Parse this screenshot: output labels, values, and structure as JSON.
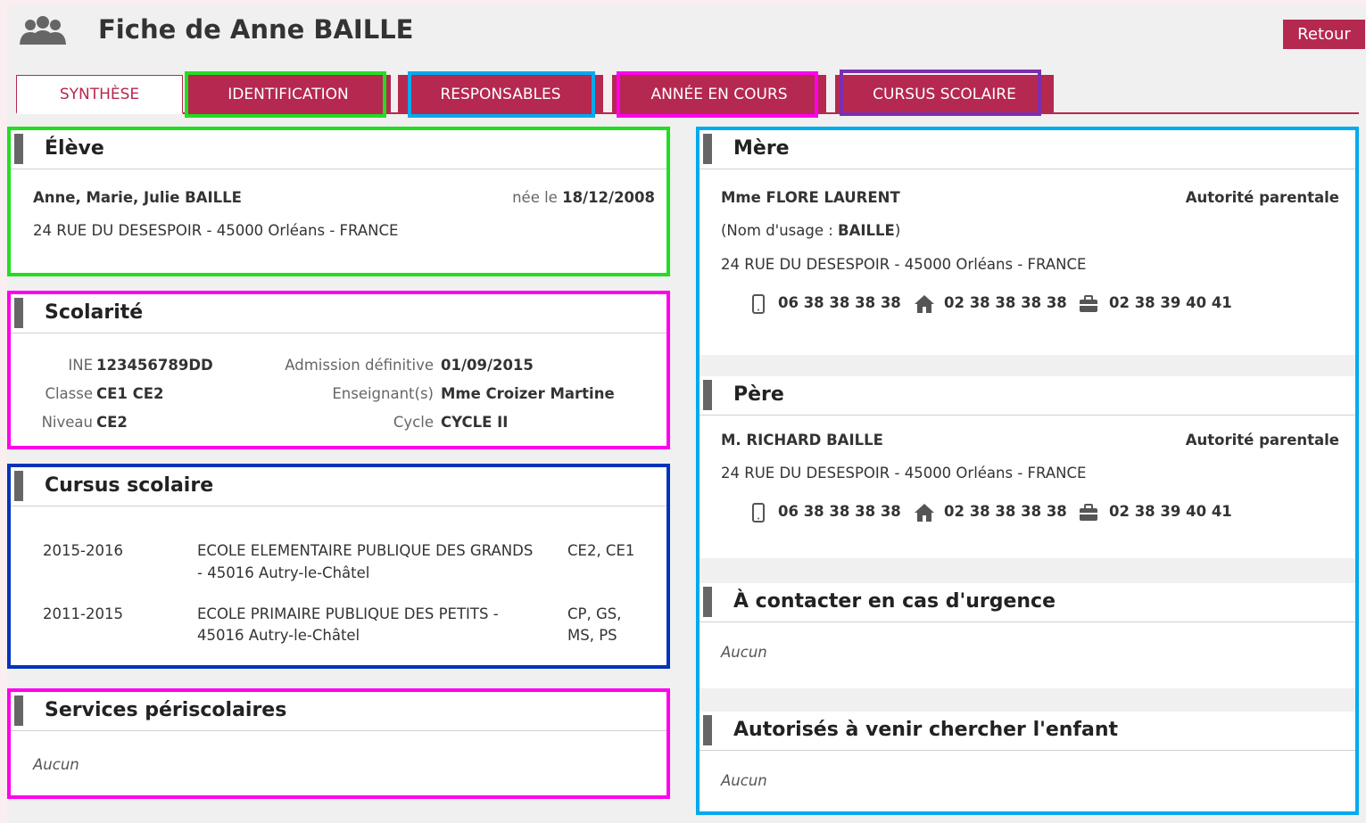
{
  "header": {
    "title": "Fiche de Anne BAILLE",
    "back_label": "Retour",
    "icon": "group-icon"
  },
  "tabs": [
    {
      "label": "SYNTHÈSE",
      "active": true
    },
    {
      "label": "IDENTIFICATION",
      "active": false
    },
    {
      "label": "RESPONSABLES",
      "active": false
    },
    {
      "label": "ANNÉE EN COURS",
      "active": false
    },
    {
      "label": "CURSUS SCOLAIRE",
      "active": false
    }
  ],
  "eleve": {
    "title": "Élève",
    "name": "Anne, Marie, Julie BAILLE",
    "born_label": "née le",
    "born_date": "18/12/2008",
    "address": "24 RUE DU DESESPOIR - 45000 Orléans - FRANCE"
  },
  "scolarite": {
    "title": "Scolarité",
    "ine_label": "INE",
    "ine": "123456789DD",
    "classe_label": "Classe",
    "classe": "CE1 CE2",
    "niveau_label": "Niveau",
    "niveau": "CE2",
    "admission_label": "Admission définitive",
    "admission": "01/09/2015",
    "enseignant_label": "Enseignant(s)",
    "enseignant": "Mme Croizer Martine",
    "cycle_label": "Cycle",
    "cycle": "CYCLE II"
  },
  "cursus": {
    "title": "Cursus scolaire",
    "rows": [
      {
        "years": "2015-2016",
        "school_line1": "ECOLE ELEMENTAIRE PUBLIQUE DES GRANDS",
        "school_line2": "- 45016 Autry-le-Châtel",
        "levels_line1": "CE2, CE1",
        "levels_line2": ""
      },
      {
        "years": "2011-2015",
        "school_line1": "ECOLE PRIMAIRE PUBLIQUE DES PETITS -",
        "school_line2": "45016 Autry-le-Châtel",
        "levels_line1": "CP, GS,",
        "levels_line2": "MS, PS"
      }
    ]
  },
  "periscolaire": {
    "title": "Services périscolaires",
    "empty": "Aucun"
  },
  "mere": {
    "title": "Mère",
    "name": "Mme FLORE LAURENT",
    "authority": "Autorité parentale",
    "usage_label": "(Nom d'usage : ",
    "usage_name": "BAILLE",
    "usage_close": ")",
    "address": "24 RUE DU DESESPOIR - 45000 Orléans - FRANCE",
    "mobile": "06 38 38 38 38",
    "home": "02 38 38 38 38",
    "work": "02 38 39 40 41"
  },
  "pere": {
    "title": "Père",
    "name": "M. RICHARD BAILLE",
    "authority": "Autorité parentale",
    "address": "24 RUE DU DESESPOIR - 45000 Orléans - FRANCE",
    "mobile": "06 38 38 38 38",
    "home": "02 38 38 38 38",
    "work": "02 38 39 40 41"
  },
  "urgence": {
    "title": "À contacter en cas d'urgence",
    "empty": "Aucun"
  },
  "autorises": {
    "title": "Autorisés à venir chercher l'enfant",
    "empty": "Aucun"
  },
  "colors": {
    "accent": "#b5284f",
    "panel_bg": "#ffffff",
    "page_bg": "#f0f0f0"
  }
}
